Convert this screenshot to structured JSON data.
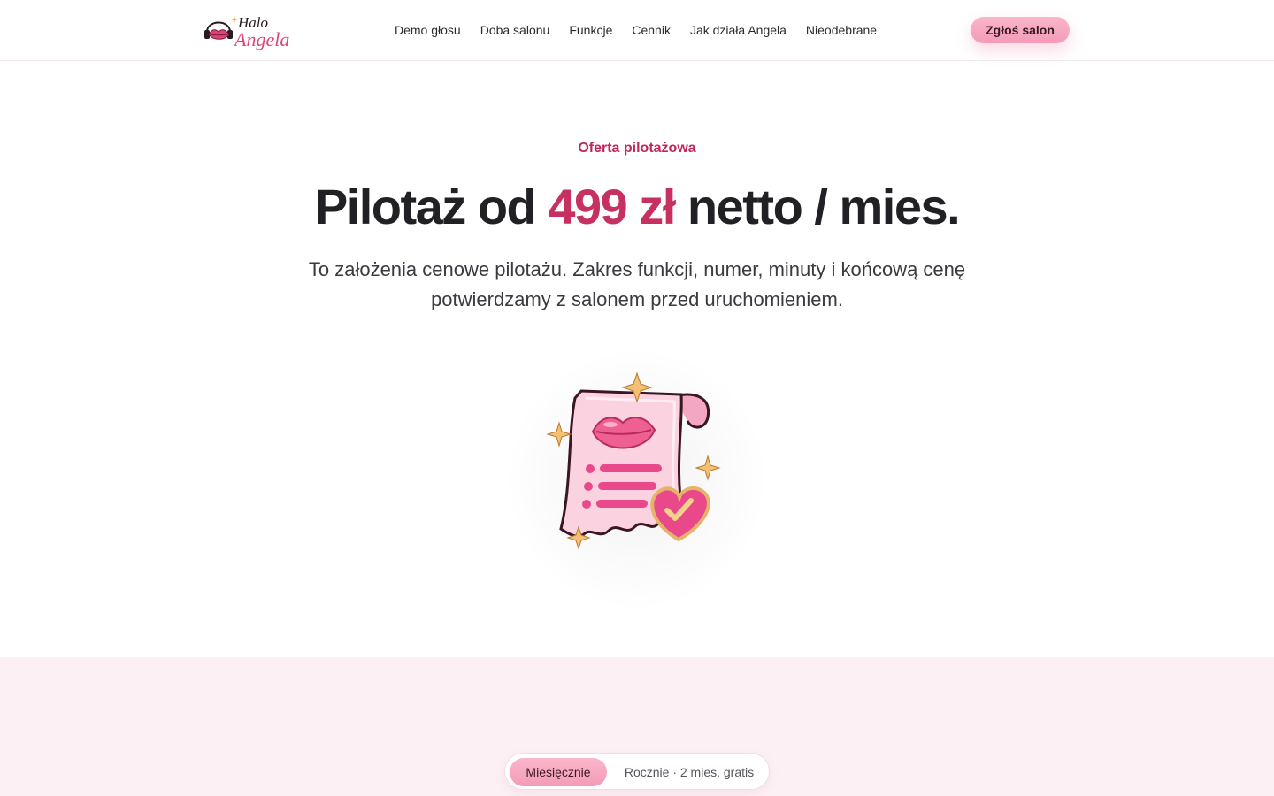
{
  "header": {
    "logo": {
      "line1": "Halo",
      "line2": "Angela"
    },
    "nav": [
      {
        "label": "Demo głosu"
      },
      {
        "label": "Doba salonu"
      },
      {
        "label": "Funkcje"
      },
      {
        "label": "Cennik"
      },
      {
        "label": "Jak działa Angela"
      },
      {
        "label": "Nieodebrane"
      }
    ],
    "cta_label": "Zgłoś salon"
  },
  "hero": {
    "eyebrow": "Oferta pilotażowa",
    "title_prefix": "Pilotaż od ",
    "title_price": "499 zł",
    "title_suffix": " netto / mies.",
    "subtitle": "To założenia cenowe pilotażu. Zakres funkcji, numer, minuty i końcową cenę potwierdzamy z salonem przed uruchomieniem.",
    "illustration": "receipt-with-lips-and-heart-icon"
  },
  "billing_toggle": {
    "monthly_label": "Miesięcznie",
    "yearly_label": "Rocznie · 2 mies. gratis",
    "selected": "monthly"
  },
  "colors": {
    "accent": "#c6315f",
    "button_pink": "#f7a8c0",
    "band_background": "#fcf0f4"
  }
}
